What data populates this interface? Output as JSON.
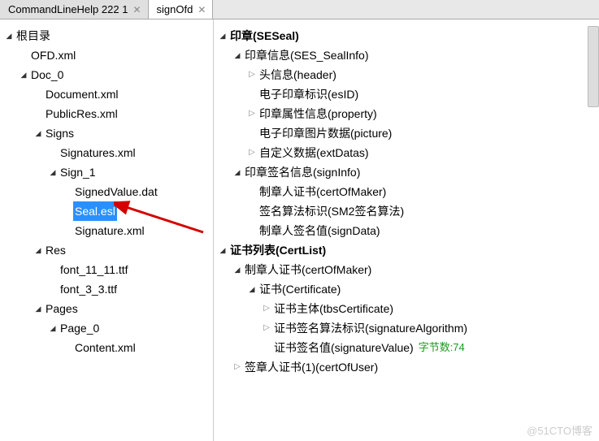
{
  "tabs": [
    {
      "label": "CommandLineHelp 222 1",
      "active": false
    },
    {
      "label": "signOfd",
      "active": true
    }
  ],
  "left_tree": [
    {
      "indent": 0,
      "arrow": "down",
      "label": "根目录",
      "interactable": true
    },
    {
      "indent": 1,
      "arrow": "blank",
      "label": "OFD.xml",
      "interactable": true
    },
    {
      "indent": 1,
      "arrow": "down",
      "label": "Doc_0",
      "interactable": true
    },
    {
      "indent": 2,
      "arrow": "blank",
      "label": "Document.xml",
      "interactable": true
    },
    {
      "indent": 2,
      "arrow": "blank",
      "label": "PublicRes.xml",
      "interactable": true
    },
    {
      "indent": 2,
      "arrow": "down",
      "label": "Signs",
      "interactable": true
    },
    {
      "indent": 3,
      "arrow": "blank",
      "label": "Signatures.xml",
      "interactable": true
    },
    {
      "indent": 3,
      "arrow": "down",
      "label": "Sign_1",
      "interactable": true
    },
    {
      "indent": 4,
      "arrow": "blank",
      "label": "SignedValue.dat",
      "interactable": true
    },
    {
      "indent": 4,
      "arrow": "blank",
      "label": "Seal.esl",
      "interactable": true,
      "selected": true
    },
    {
      "indent": 4,
      "arrow": "blank",
      "label": "Signature.xml",
      "interactable": true
    },
    {
      "indent": 2,
      "arrow": "down",
      "label": "Res",
      "interactable": true
    },
    {
      "indent": 3,
      "arrow": "blank",
      "label": "font_11_11.ttf",
      "interactable": true
    },
    {
      "indent": 3,
      "arrow": "blank",
      "label": "font_3_3.ttf",
      "interactable": true
    },
    {
      "indent": 2,
      "arrow": "down",
      "label": "Pages",
      "interactable": true
    },
    {
      "indent": 3,
      "arrow": "down",
      "label": "Page_0",
      "interactable": true
    },
    {
      "indent": 4,
      "arrow": "blank",
      "label": "Content.xml",
      "interactable": true
    }
  ],
  "right_tree": [
    {
      "indent": 0,
      "arrow": "down",
      "label": "印章(SESeal)",
      "bold": true
    },
    {
      "indent": 1,
      "arrow": "down",
      "label": "印章信息(SES_SealInfo)"
    },
    {
      "indent": 2,
      "arrow": "right",
      "label": "头信息(header)"
    },
    {
      "indent": 2,
      "arrow": "blank",
      "label": "电子印章标识(esID)"
    },
    {
      "indent": 2,
      "arrow": "right",
      "label": "印章属性信息(property)"
    },
    {
      "indent": 2,
      "arrow": "blank",
      "label": "电子印章图片数据(picture)"
    },
    {
      "indent": 2,
      "arrow": "right",
      "label": "自定义数据(extDatas)"
    },
    {
      "indent": 1,
      "arrow": "down",
      "label": "印章签名信息(signInfo)"
    },
    {
      "indent": 2,
      "arrow": "blank",
      "label": "制章人证书(certOfMaker)"
    },
    {
      "indent": 2,
      "arrow": "blank",
      "label": "签名算法标识(SM2签名算法)"
    },
    {
      "indent": 2,
      "arrow": "blank",
      "label": "制章人签名值(signData)"
    },
    {
      "indent": 0,
      "arrow": "down",
      "label": "证书列表(CertList)",
      "bold": true
    },
    {
      "indent": 1,
      "arrow": "down",
      "label": "制章人证书(certOfMaker)"
    },
    {
      "indent": 2,
      "arrow": "down",
      "label": "证书(Certificate)"
    },
    {
      "indent": 3,
      "arrow": "right",
      "label": "证书主体(tbsCertificate)"
    },
    {
      "indent": 3,
      "arrow": "right",
      "label": "证书签名算法标识(signatureAlgorithm)"
    },
    {
      "indent": 3,
      "arrow": "blank",
      "label": "证书签名值(signatureValue)",
      "suffix": "字节数:74"
    },
    {
      "indent": 1,
      "arrow": "right",
      "label": "签章人证书(1)(certOfUser)"
    }
  ],
  "watermark": "@51CTO博客"
}
